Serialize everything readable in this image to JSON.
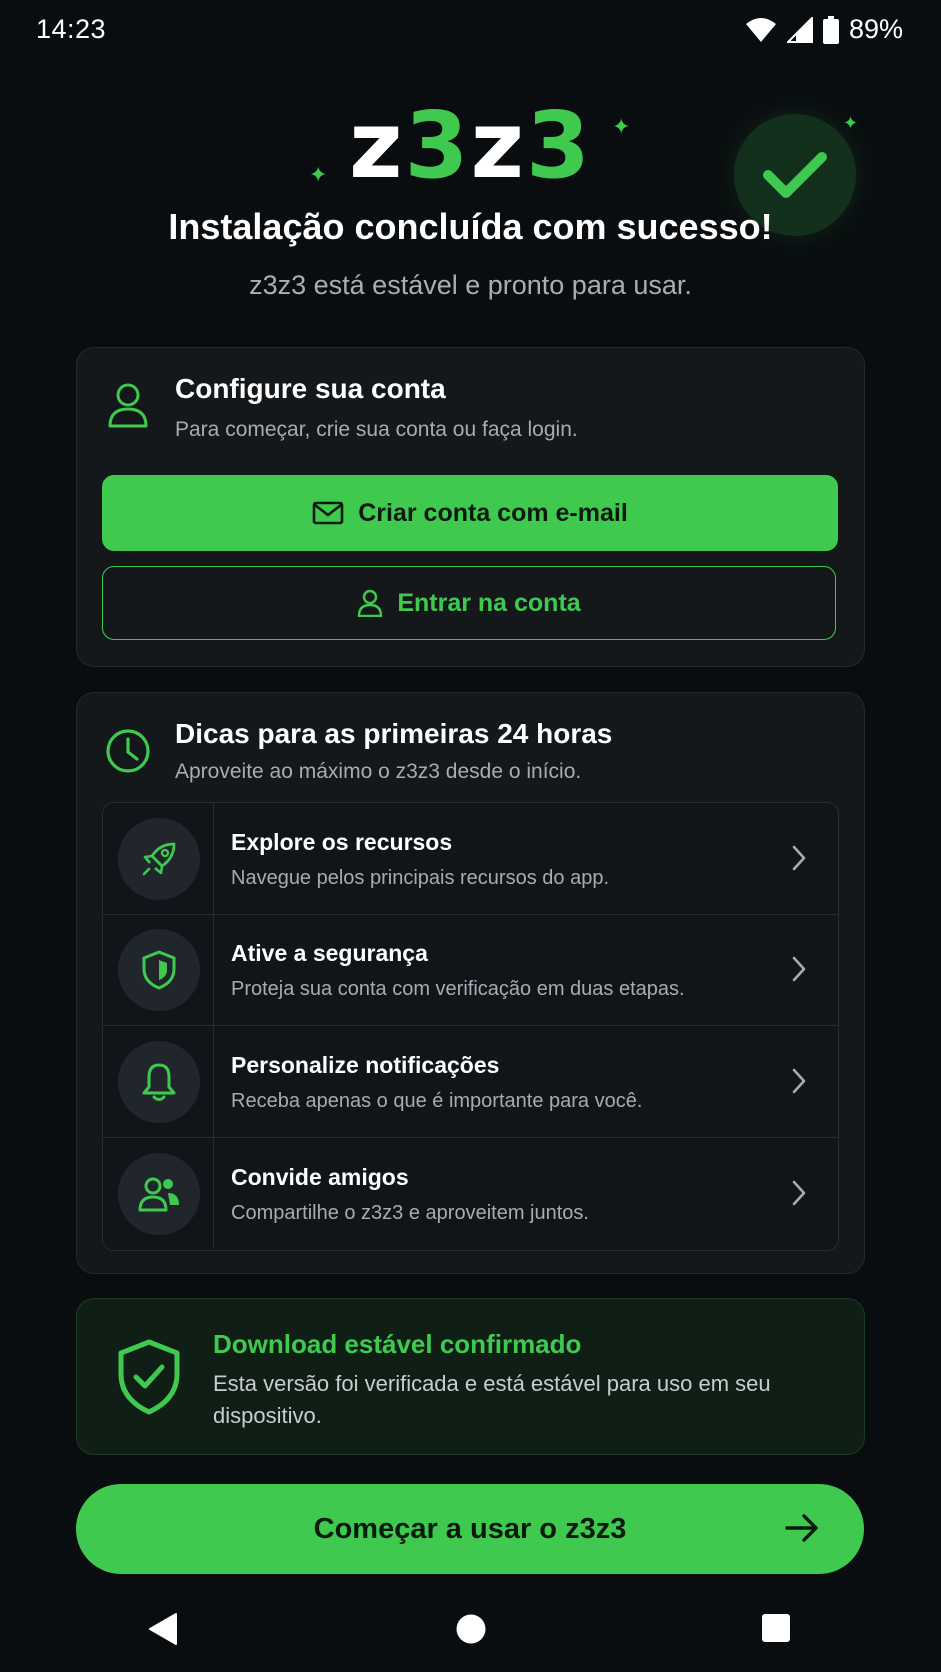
{
  "status_bar": {
    "time": "14:23",
    "battery": "89%",
    "icons": [
      "wifi-icon",
      "signal-icon",
      "battery-icon"
    ]
  },
  "header": {
    "logo": {
      "z1": "z",
      "n1": "3",
      "z2": "z",
      "n2": "3"
    },
    "headline": "Instalação concluída com sucesso!",
    "subhead": "z3z3 está estável e pronto para usar."
  },
  "account": {
    "title": "Configure sua conta",
    "desc": "Para começar, crie sua conta ou faça login.",
    "primary_label": "Criar conta com e-mail",
    "secondary_label": "Entrar na conta"
  },
  "tips": {
    "title": "Dicas para as primeiras 24 horas",
    "desc": "Aproveite ao máximo o z3z3 desde o início.",
    "items": [
      {
        "title": "Explore os recursos",
        "desc": "Navegue pelos principais recursos do app.",
        "icon": "rocket-icon"
      },
      {
        "title": "Ative a segurança",
        "desc": "Proteja sua conta com verificação em duas etapas.",
        "icon": "shield-icon"
      },
      {
        "title": "Personalize notificações",
        "desc": "Receba apenas o que é importante para você.",
        "icon": "bell-icon"
      },
      {
        "title": "Convide amigos",
        "desc": "Compartilhe o z3z3 e aproveitem juntos.",
        "icon": "people-icon"
      }
    ]
  },
  "stable": {
    "title": "Download estável confirmado",
    "desc": "Esta versão foi verificada e está estável para uso em seu dispositivo."
  },
  "cta": {
    "label": "Começar a usar o z3z3"
  },
  "colors": {
    "accent": "#3fca4f",
    "background": "#0a0d10",
    "card": "#14181b"
  }
}
